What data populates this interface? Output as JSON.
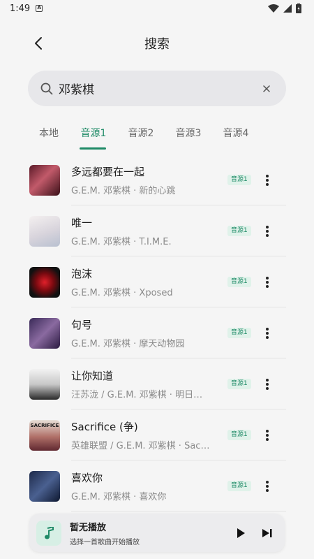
{
  "status_bar": {
    "time": "1:49",
    "sim_label": "A"
  },
  "header": {
    "title": "搜索"
  },
  "search": {
    "query": "邓紫棋",
    "placeholder": ""
  },
  "tabs": [
    {
      "label": "本地",
      "active": false
    },
    {
      "label": "音源1",
      "active": true
    },
    {
      "label": "音源2",
      "active": false
    },
    {
      "label": "音源3",
      "active": false
    },
    {
      "label": "音源4",
      "active": false
    }
  ],
  "songs": [
    {
      "title": "多远都要在一起",
      "subtitle": "G.E.M. 邓紫棋 · 新的心跳",
      "badge": "音源1"
    },
    {
      "title": "唯一",
      "subtitle": "G.E.M. 邓紫棋 · T.I.M.E.",
      "badge": "音源1"
    },
    {
      "title": "泡沫",
      "subtitle": "G.E.M. 邓紫棋 · Xposed",
      "badge": "音源1"
    },
    {
      "title": "句号",
      "subtitle": "G.E.M. 邓紫棋 · 摩天动物园",
      "badge": "音源1"
    },
    {
      "title": "让你知道",
      "subtitle": "汪苏泷 / G.E.M. 邓紫棋 · 明日…",
      "badge": "音源1"
    },
    {
      "title": "Sacrifice (争)",
      "subtitle": "英雄联盟 / G.E.M. 邓紫棋 · Sac…",
      "badge": "音源1",
      "cover_text": "SACRIFICE"
    },
    {
      "title": "喜欢你",
      "subtitle": "G.E.M. 邓紫棋 · 喜欢你",
      "badge": "音源1"
    }
  ],
  "player": {
    "title": "暂无播放",
    "subtitle": "选择一首歌曲开始播放"
  },
  "colors": {
    "accent": "#1e8a66",
    "background": "#f5f5f5",
    "search_bg": "#e7e7ea"
  }
}
